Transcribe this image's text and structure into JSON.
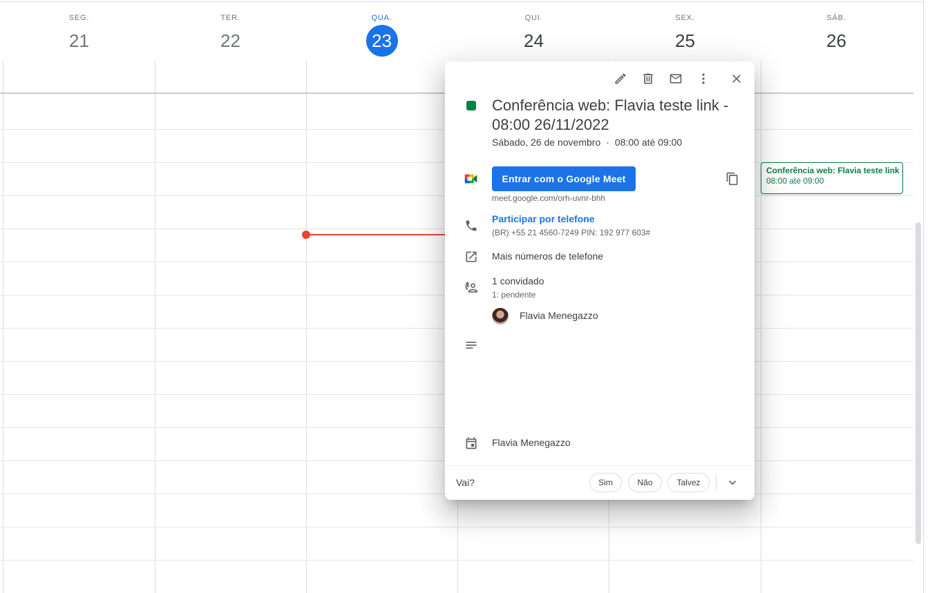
{
  "week": {
    "days": [
      {
        "dow": "SEG.",
        "num": "21"
      },
      {
        "dow": "TER.",
        "num": "22"
      },
      {
        "dow": "QUA.",
        "num": "23"
      },
      {
        "dow": "QUI.",
        "num": "24"
      },
      {
        "dow": "SEX.",
        "num": "25"
      },
      {
        "dow": "SÁB.",
        "num": "26"
      }
    ]
  },
  "event_chip": {
    "title": "Conferência web: Flavia teste link - 08:00 26/11/2022",
    "time": "08:00 até 09:00"
  },
  "popup": {
    "toolbar": {
      "edit_icon": "pencil-icon",
      "delete_icon": "trash-icon",
      "email_icon": "mail-icon",
      "more_icon": "more-vert-icon",
      "close_icon": "close-icon"
    },
    "color": "#0b8043",
    "title": "Conferência web: Flavia teste link - 08:00 26/11/2022",
    "date": "Sábado, 26 de novembro",
    "date_sep": "·",
    "time": "08:00 até 09:00",
    "meet": {
      "button_label": "Entrar com o Google Meet",
      "link": "meet.google.com/orh-uvnr-bhh"
    },
    "phone": {
      "label": "Participar por telefone",
      "number": "(BR) +55 21 4560-7249 PIN: 192 977 603#"
    },
    "more_phones": "Mais números de telefone",
    "guests": {
      "count": "1 convidado",
      "status": "1: pendente",
      "list": [
        {
          "name": "Flavia Menegazzo"
        }
      ]
    },
    "organizer": "Flavia Menegazzo",
    "rsvp": {
      "question": "Vai?",
      "yes": "Sim",
      "no": "Não",
      "maybe": "Talvez"
    }
  },
  "colors": {
    "accent": "#1a73e8",
    "event": "#0b8043",
    "now_line": "#ea4335"
  }
}
